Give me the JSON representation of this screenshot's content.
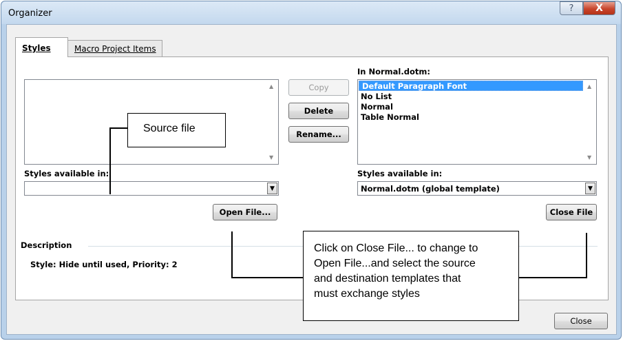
{
  "window": {
    "title": "Organizer",
    "help_symbol": "?",
    "close_symbol": "X"
  },
  "tabs": [
    {
      "label": "Styles",
      "active": true
    },
    {
      "label": "Macro Project Items",
      "active": false
    }
  ],
  "left_panel": {
    "items": [],
    "styles_available_label": "Styles available in:",
    "styles_available_value": "",
    "open_file_button": "Open File..."
  },
  "buttons": {
    "copy": "Copy",
    "delete": "Delete",
    "rename": "Rename...",
    "close": "Close"
  },
  "right_panel": {
    "in_label": "In Normal.dotm:",
    "items": [
      "Default Paragraph Font",
      "No List",
      "Normal",
      "Table Normal"
    ],
    "selected_index": 0,
    "styles_available_label": "Styles available in:",
    "styles_available_value": "Normal.dotm (global template)",
    "close_file_button": "Close File"
  },
  "description": {
    "label": "Description",
    "text": "Style: Hide until used, Priority: 2"
  },
  "callouts": {
    "source": "Source file",
    "close_file_lines": [
      "Click on Close File... to change to",
      "Open File...and  select the source",
      "and destination templates that",
      "must exchange styles"
    ]
  }
}
